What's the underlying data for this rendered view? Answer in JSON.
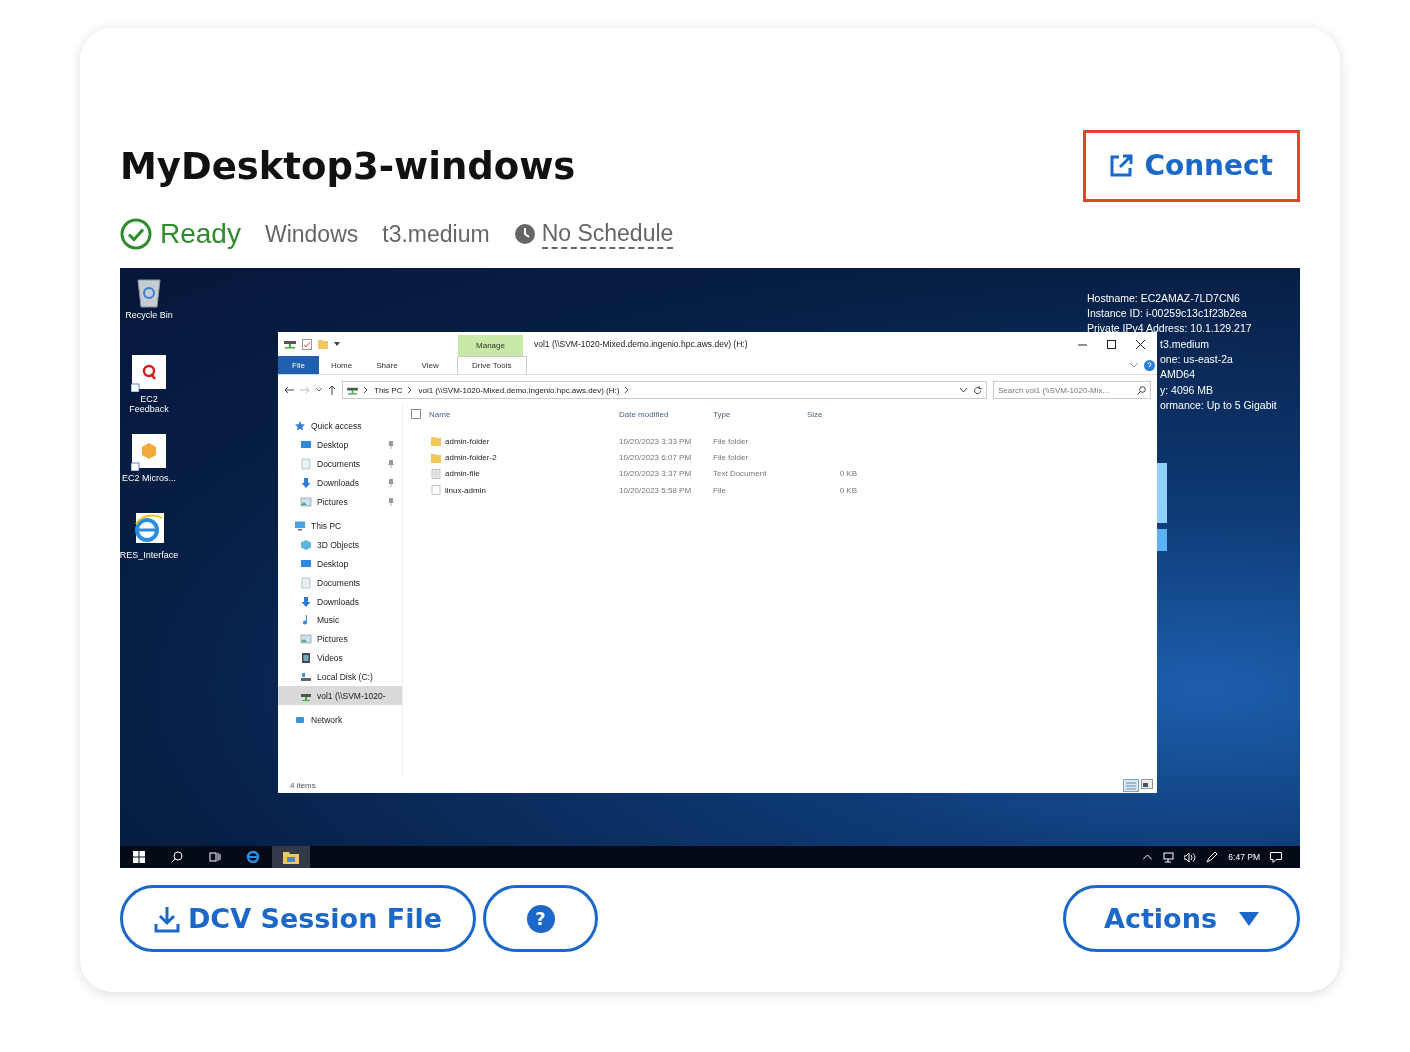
{
  "card": {
    "title": "MyDesktop3-windows",
    "connect_button": "Connect",
    "status": {
      "label": "Ready",
      "kind": "ready"
    },
    "os": "Windows",
    "instance_type": "t3.medium",
    "schedule": "No Schedule",
    "screenshot": {
      "desktop_icons": [
        {
          "label": "Recycle Bin",
          "kind": "bin"
        },
        {
          "label": "EC2 Feedback",
          "kind": "feedback"
        },
        {
          "label": "EC2 Micros...",
          "kind": "box"
        },
        {
          "label": "RES_Interface",
          "kind": "browser"
        }
      ],
      "info_lines": [
        "Hostname: EC2AMAZ-7LD7CN6",
        "Instance ID: i-00259c13c1f23b2ea",
        "Private IPv4 Address: 10.1.129.217"
      ],
      "info_lines_cut": [
        "t3.medium",
        "one: us-east-2a",
        "AMD64",
        "y: 4096 MB",
        "ormance: Up to 5 Gigabit"
      ],
      "explorer": {
        "title": "vol1 (\\\\SVM-1020-Mixed.demo.ingenio.hpc.aws.dev) (H:)",
        "contextual_group": "Manage",
        "ribbon_tabs": [
          {
            "label": "File",
            "kind": "file"
          },
          {
            "label": "Home",
            "kind": "tab"
          },
          {
            "label": "Share",
            "kind": "tab"
          },
          {
            "label": "View",
            "kind": "tab"
          },
          {
            "label": "Drive Tools",
            "kind": "contextual"
          }
        ],
        "breadcrumb": [
          "This PC",
          "vol1 (\\\\SVM-1020-Mixed.demo.ingenio.hpc.aws.dev) (H:)"
        ],
        "search": {
          "placeholder": "Search vol1 (\\\\SVM-1020-Mix..."
        },
        "nav": [
          {
            "label": "Quick access",
            "kind": "star",
            "selected": false,
            "children": [
              {
                "label": "Desktop",
                "kind": "desktop",
                "pinned": true,
                "selected": false
              },
              {
                "label": "Documents",
                "kind": "documents",
                "pinned": true,
                "selected": false
              },
              {
                "label": "Downloads",
                "kind": "downloads",
                "pinned": true,
                "selected": false
              },
              {
                "label": "Pictures",
                "kind": "pictures",
                "pinned": true,
                "selected": false
              }
            ]
          },
          {
            "label": "This PC",
            "kind": "pc",
            "selected": false,
            "children": [
              {
                "label": "3D Objects",
                "kind": "objects",
                "pinned": false,
                "selected": false
              },
              {
                "label": "Desktop",
                "kind": "desktop",
                "pinned": false,
                "selected": false
              },
              {
                "label": "Documents",
                "kind": "documents",
                "pinned": false,
                "selected": false
              },
              {
                "label": "Downloads",
                "kind": "downloads",
                "pinned": false,
                "selected": false
              },
              {
                "label": "Music",
                "kind": "music",
                "pinned": false,
                "selected": false
              },
              {
                "label": "Pictures",
                "kind": "pictures",
                "pinned": false,
                "selected": false
              },
              {
                "label": "Videos",
                "kind": "videos",
                "pinned": false,
                "selected": false
              },
              {
                "label": "Local Disk (C:)",
                "kind": "disk",
                "pinned": false,
                "selected": false
              },
              {
                "label": "vol1 (\\\\SVM-1020-",
                "kind": "netdrive",
                "pinned": false,
                "selected": true
              }
            ]
          },
          {
            "label": "Network",
            "kind": "network",
            "selected": false
          }
        ],
        "select_all_checked": false,
        "columns": [
          "Name",
          "Date modified",
          "Type",
          "Size"
        ],
        "rows": [
          {
            "kind": "folder",
            "name": "admin-folder",
            "date": "10/20/2023 3:33 PM",
            "type": "File folder"
          },
          {
            "kind": "folder",
            "name": "admin-folder-2",
            "date": "10/20/2023 6:07 PM",
            "type": "File folder"
          },
          {
            "kind": "text",
            "name": "admin-file",
            "date": "10/20/2023 3:37 PM",
            "type": "Text Document",
            "size": "0 KB"
          },
          {
            "kind": "file",
            "name": "linux-admin",
            "date": "10/20/2023 5:58 PM",
            "type": "File",
            "size": "0 KB"
          }
        ],
        "status": "4 items"
      },
      "taskbar": {
        "clock": "6:47 PM"
      }
    },
    "buttons": {
      "session_file": "DCV Session File",
      "help": "?",
      "actions": "Actions"
    }
  }
}
